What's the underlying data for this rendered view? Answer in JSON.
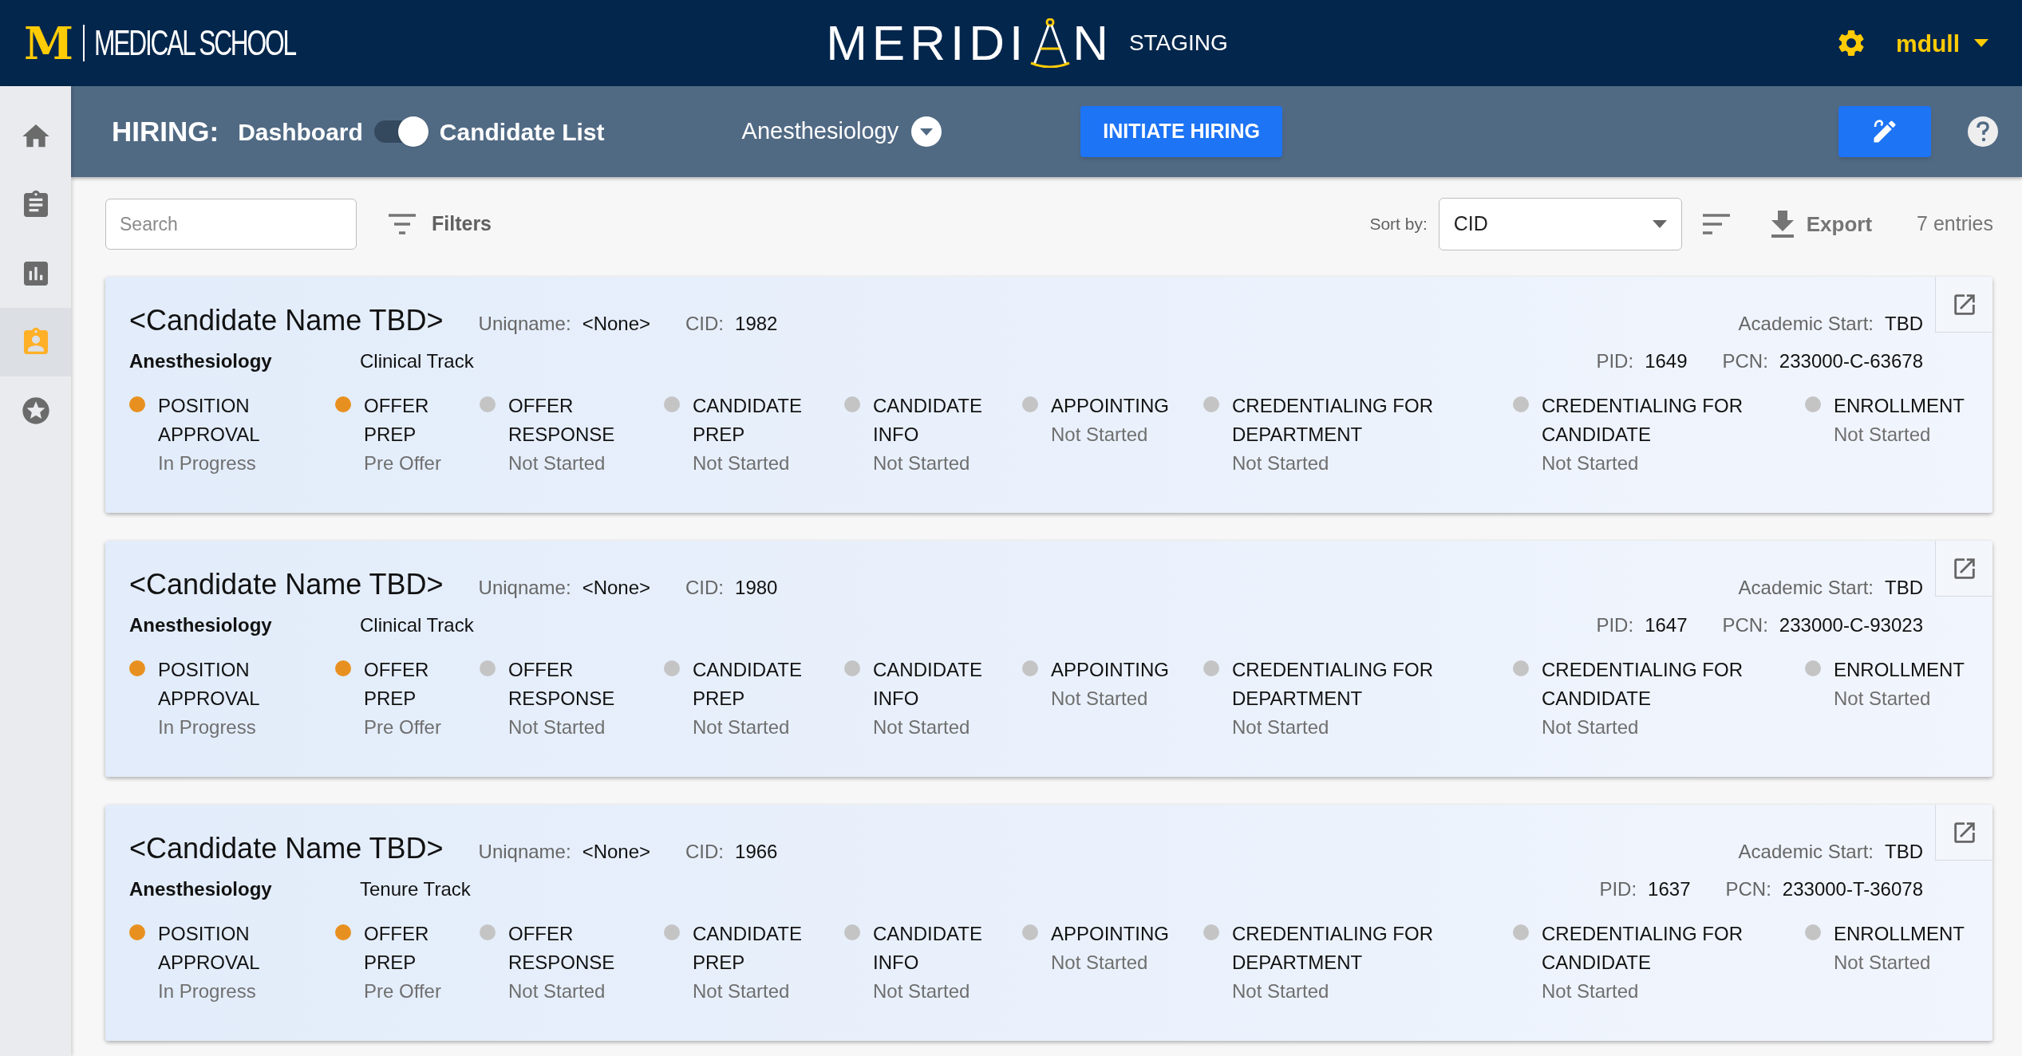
{
  "header": {
    "logo_letter": "M",
    "school": "MEDICAL SCHOOL",
    "app_name_start": "MERIDI",
    "app_name_end": "N",
    "environment": "STAGING",
    "user": "mdull"
  },
  "sidebar": {
    "items": [
      {
        "kind": "home",
        "selected": false
      },
      {
        "kind": "clipboard",
        "selected": false
      },
      {
        "kind": "chart",
        "selected": false
      },
      {
        "kind": "badge",
        "selected": true
      },
      {
        "kind": "star",
        "selected": false
      }
    ]
  },
  "toolbar": {
    "section": "HIRING:",
    "view_left": "Dashboard",
    "view_right": "Candidate List",
    "toggle_on": true,
    "department": "Anesthesiology",
    "primary_button": "INITIATE HIRING"
  },
  "filters": {
    "search_placeholder": "Search",
    "filters_label": "Filters",
    "sort_label": "Sort by:",
    "sort_value": "CID",
    "export_label": "Export",
    "entries": "7 entries"
  },
  "candidates": [
    {
      "name": "<Candidate Name TBD>",
      "uniqname_label": "Uniqname:",
      "uniqname": "<None>",
      "cid_label": "CID:",
      "cid": "1982",
      "academic_start_label": "Academic Start:",
      "academic_start": "TBD",
      "department": "Anesthesiology",
      "track": "Clinical Track",
      "pid_label": "PID:",
      "pid": "1649",
      "pcn_label": "PCN:",
      "pcn": "233000-C-63678",
      "steps": [
        {
          "title": "POSITION APPROVAL",
          "status": "In Progress",
          "color": "#e8901f"
        },
        {
          "title": "OFFER PREP",
          "status": "Pre Offer",
          "color": "#e8901f"
        },
        {
          "title": "OFFER RESPONSE",
          "status": "Not Started",
          "color": "#c4c4c4"
        },
        {
          "title": "CANDIDATE PREP",
          "status": "Not Started",
          "color": "#c4c4c4"
        },
        {
          "title": "CANDIDATE INFO",
          "status": "Not Started",
          "color": "#c4c4c4"
        },
        {
          "title": "APPOINTING",
          "status": "Not Started",
          "color": "#c4c4c4"
        },
        {
          "title": "CREDENTIALING FOR DEPARTMENT",
          "status": "Not Started",
          "color": "#c4c4c4"
        },
        {
          "title": "CREDENTIALING FOR CANDIDATE",
          "status": "Not Started",
          "color": "#c4c4c4"
        },
        {
          "title": "ENROLLMENT",
          "status": "Not Started",
          "color": "#c4c4c4"
        }
      ]
    },
    {
      "name": "<Candidate Name TBD>",
      "uniqname_label": "Uniqname:",
      "uniqname": "<None>",
      "cid_label": "CID:",
      "cid": "1980",
      "academic_start_label": "Academic Start:",
      "academic_start": "TBD",
      "department": "Anesthesiology",
      "track": "Clinical Track",
      "pid_label": "PID:",
      "pid": "1647",
      "pcn_label": "PCN:",
      "pcn": "233000-C-93023",
      "steps": [
        {
          "title": "POSITION APPROVAL",
          "status": "In Progress",
          "color": "#e8901f"
        },
        {
          "title": "OFFER PREP",
          "status": "Pre Offer",
          "color": "#e8901f"
        },
        {
          "title": "OFFER RESPONSE",
          "status": "Not Started",
          "color": "#c4c4c4"
        },
        {
          "title": "CANDIDATE PREP",
          "status": "Not Started",
          "color": "#c4c4c4"
        },
        {
          "title": "CANDIDATE INFO",
          "status": "Not Started",
          "color": "#c4c4c4"
        },
        {
          "title": "APPOINTING",
          "status": "Not Started",
          "color": "#c4c4c4"
        },
        {
          "title": "CREDENTIALING FOR DEPARTMENT",
          "status": "Not Started",
          "color": "#c4c4c4"
        },
        {
          "title": "CREDENTIALING FOR CANDIDATE",
          "status": "Not Started",
          "color": "#c4c4c4"
        },
        {
          "title": "ENROLLMENT",
          "status": "Not Started",
          "color": "#c4c4c4"
        }
      ]
    },
    {
      "name": "<Candidate Name TBD>",
      "uniqname_label": "Uniqname:",
      "uniqname": "<None>",
      "cid_label": "CID:",
      "cid": "1966",
      "academic_start_label": "Academic Start:",
      "academic_start": "TBD",
      "department": "Anesthesiology",
      "track": "Tenure Track",
      "pid_label": "PID:",
      "pid": "1637",
      "pcn_label": "PCN:",
      "pcn": "233000-T-36078",
      "steps": [
        {
          "title": "POSITION APPROVAL",
          "status": "In Progress",
          "color": "#e8901f"
        },
        {
          "title": "OFFER PREP",
          "status": "Pre Offer",
          "color": "#e8901f"
        },
        {
          "title": "OFFER RESPONSE",
          "status": "Not Started",
          "color": "#c4c4c4"
        },
        {
          "title": "CANDIDATE PREP",
          "status": "Not Started",
          "color": "#c4c4c4"
        },
        {
          "title": "CANDIDATE INFO",
          "status": "Not Started",
          "color": "#c4c4c4"
        },
        {
          "title": "APPOINTING",
          "status": "Not Started",
          "color": "#c4c4c4"
        },
        {
          "title": "CREDENTIALING FOR DEPARTMENT",
          "status": "Not Started",
          "color": "#c4c4c4"
        },
        {
          "title": "CREDENTIALING FOR CANDIDATE",
          "status": "Not Started",
          "color": "#c4c4c4"
        },
        {
          "title": "ENROLLMENT",
          "status": "Not Started",
          "color": "#c4c4c4"
        }
      ]
    }
  ]
}
